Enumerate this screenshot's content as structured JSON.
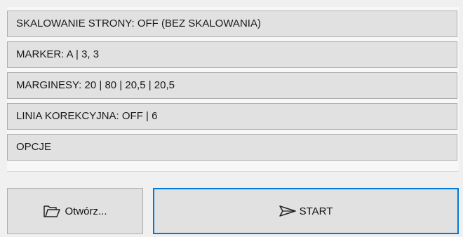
{
  "settings": {
    "items": [
      {
        "label": "SKALOWANIE STRONY: OFF (BEZ SKALOWANIA)"
      },
      {
        "label": "MARKER: A | 3, 3"
      },
      {
        "label": "MARGINESY: 20 | 80 | 20,5 | 20,5"
      },
      {
        "label": "LINIA KOREKCYJNA: OFF | 6"
      },
      {
        "label": "OPCJE"
      }
    ]
  },
  "actions": {
    "open_label": "Otwórz...",
    "open_icon": "folder-open-icon",
    "start_label": "START",
    "start_icon": "paper-plane-icon"
  },
  "colors": {
    "background": "#f0f0f0",
    "button_face": "#e1e1e1",
    "button_border": "#adadad",
    "focus_border": "#0078d7"
  }
}
